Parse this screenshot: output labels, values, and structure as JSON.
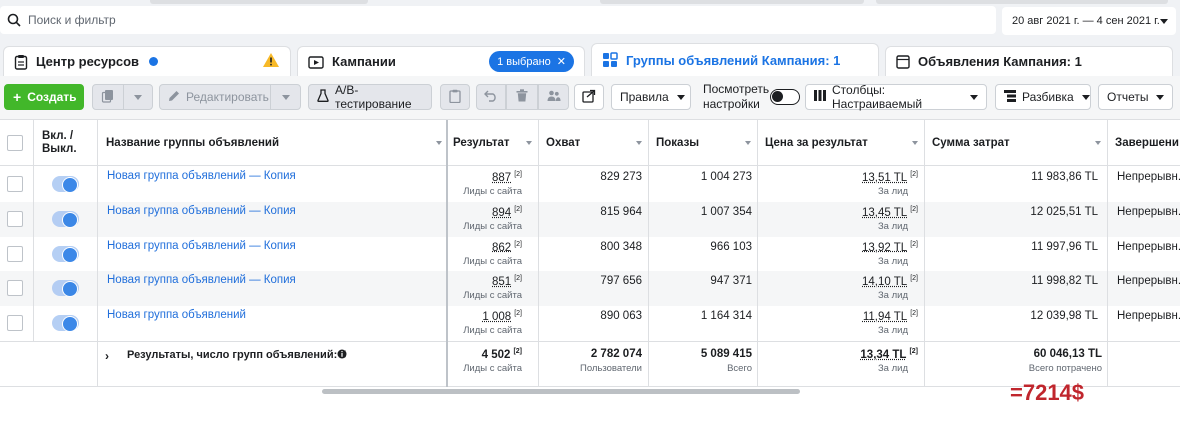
{
  "search": {
    "placeholder": "Поиск и фильтр"
  },
  "date_range": "20 авг 2021 г. — 4 сен 2021 г.",
  "tabs": {
    "resources": "Центр ресурсов",
    "campaigns": "Кампании",
    "selected_pill": "1 выбрано",
    "adsets": "Группы объявлений Кампания: 1",
    "ads": "Объявления Кампания: 1"
  },
  "toolbar": {
    "create": "Создать",
    "edit": "Редактировать",
    "ab_test": "А/В-тестирование",
    "rules": "Правила",
    "view_settings_1": "Посмотреть",
    "view_settings_2": "настройки",
    "columns": "Столбцы: Настраиваемый",
    "breakdown": "Разбивка",
    "reports": "Отчеты"
  },
  "columns": {
    "onoff_1": "Вкл. /",
    "onoff_2": "Выкл.",
    "name": "Название группы объявлений",
    "result": "Результат",
    "reach": "Охват",
    "impressions": "Показы",
    "cost_per_result": "Цена за результат",
    "spent": "Сумма затрат",
    "ends": "Завершени"
  },
  "rows": [
    {
      "name": "Новая группа объявлений — Копия",
      "result": "887",
      "result_sub": "Лиды с сайта",
      "reach": "829 273",
      "impressions": "1 004 273",
      "cpr": "13,51 TL",
      "cpr_sub": "За лид",
      "spent": "11 983,86 TL",
      "ends": "Непрерывн..."
    },
    {
      "name": "Новая группа объявлений — Копия",
      "result": "894",
      "result_sub": "Лиды с сайта",
      "reach": "815 964",
      "impressions": "1 007 354",
      "cpr": "13,45 TL",
      "cpr_sub": "За лид",
      "spent": "12 025,51 TL",
      "ends": "Непрерывн..."
    },
    {
      "name": "Новая группа объявлений — Копия",
      "result": "862",
      "result_sub": "Лиды с сайта",
      "reach": "800 348",
      "impressions": "966 103",
      "cpr": "13,92 TL",
      "cpr_sub": "За лид",
      "spent": "11 997,96 TL",
      "ends": "Непрерывн..."
    },
    {
      "name": "Новая группа объявлений — Копия",
      "result": "851",
      "result_sub": "Лиды с сайта",
      "reach": "797 656",
      "impressions": "947 371",
      "cpr": "14,10 TL",
      "cpr_sub": "За лид",
      "spent": "11 998,82 TL",
      "ends": "Непрерывн..."
    },
    {
      "name": "Новая группа объявлений",
      "result": "1 008",
      "result_sub": "Лиды с сайта",
      "reach": "890 063",
      "impressions": "1 164 314",
      "cpr": "11,94 TL",
      "cpr_sub": "За лид",
      "spent": "12 039,98 TL",
      "ends": "Непрерывн..."
    }
  ],
  "footnote_mark": "[2]",
  "summary": {
    "label": "Результаты, число групп объявлений: 5",
    "result": "4 502",
    "result_sub": "Лиды с сайта",
    "reach": "2 782 074",
    "reach_sub": "Пользователи",
    "impressions": "5 089 415",
    "impressions_sub": "Всего",
    "cpr": "13,34 TL",
    "cpr_sub": "За лид",
    "spent": "60 046,13 TL",
    "spent_sub": "Всего потрачено"
  },
  "annotation": "=7214$",
  "colors": {
    "accent": "#1b74e4",
    "create_green": "#42b72a",
    "warning": "#f7b928",
    "annotation_red": "#c0262d"
  }
}
